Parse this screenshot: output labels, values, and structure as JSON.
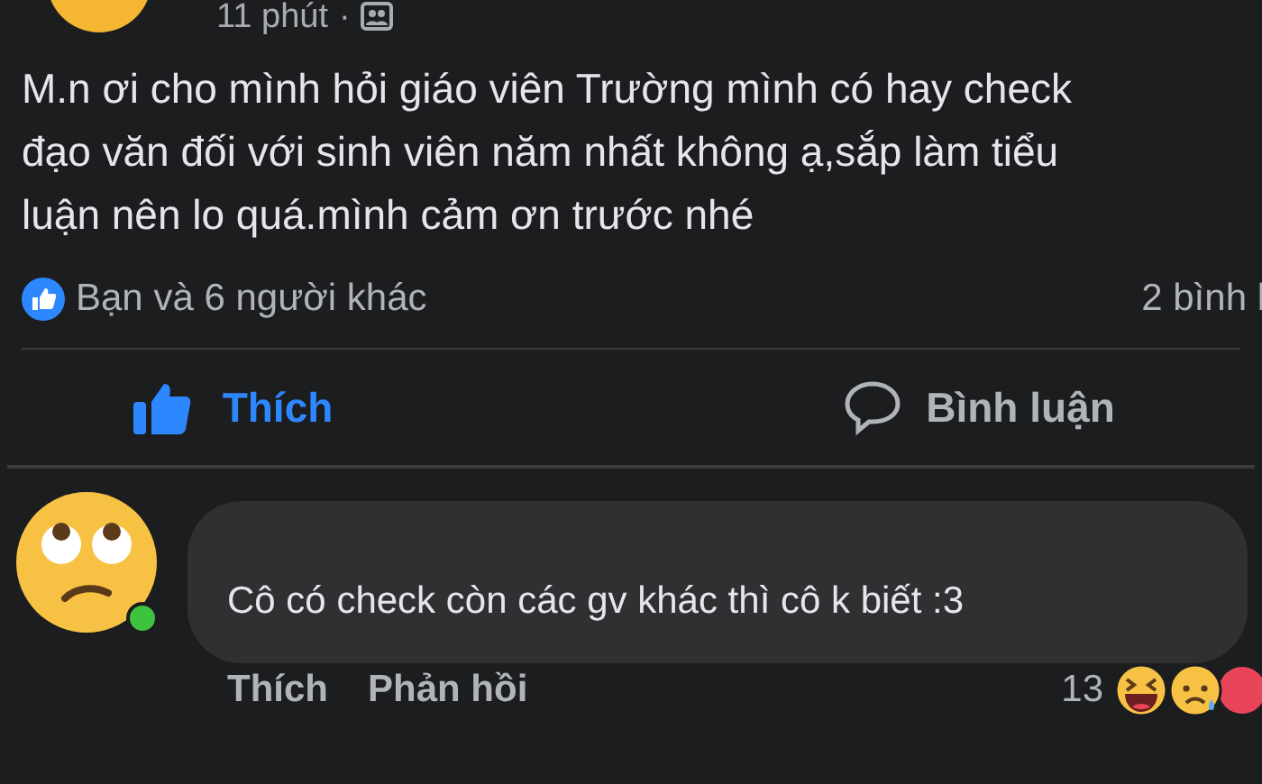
{
  "post": {
    "time": "11 phút",
    "separator": "·",
    "text_lines": [
      "M.n ơi cho mình hỏi giáo viên Trường mình có hay check",
      "đạo văn đối với sinh viên năm nhất không ạ,sắp làm tiểu",
      "luận nên lo quá.mình cảm ơn trước nhé"
    ],
    "reactions_summary": "Bạn và 6 người khác",
    "comments_count": "2 bình l",
    "actions": [
      {
        "kind": "like",
        "label": "Thích",
        "selected": true
      },
      {
        "kind": "comment",
        "label": "Bình luận",
        "selected": false
      }
    ]
  },
  "comment": {
    "online": true,
    "text": "Cô có check còn các gv khác thì cô k biết :3",
    "actions": [
      "Thích",
      "Phản hồi"
    ],
    "reaction_count": "13"
  }
}
